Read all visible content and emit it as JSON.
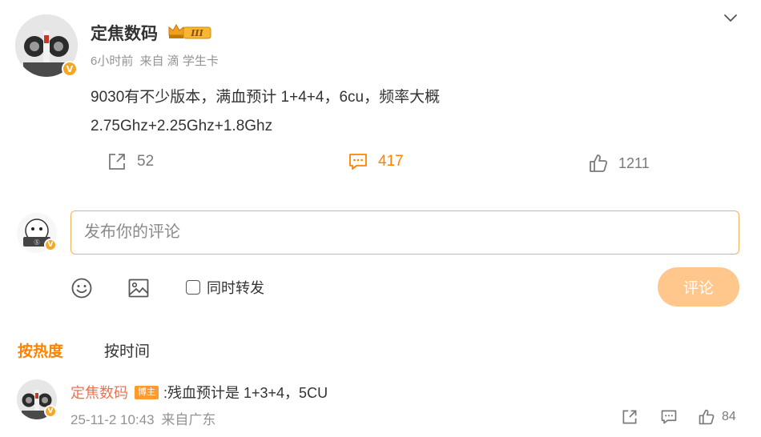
{
  "post": {
    "author_name": "定焦数码",
    "level_badge": "III",
    "time": "6小时前",
    "source": "来自 滴 学生卡",
    "text_line1": "9030有不少版本，满血预计 1+4+4，6cu，频率大概",
    "text_line2": "2.75Ghz+2.25Ghz+1.8Ghz",
    "repost_count": "52",
    "comment_count": "417",
    "like_count": "1211"
  },
  "composer": {
    "placeholder": "发布你的评论",
    "repost_label": "同时转发",
    "submit_label": "评论"
  },
  "sort": {
    "hot_label": "按热度",
    "time_label": "按时间"
  },
  "reply": {
    "author": "定焦数码",
    "blogger_tag": "博主",
    "text": ":残血预计是 1+3+4，5CU",
    "time": "25-11-2 10:43",
    "source": "来自广东",
    "like_count": "84"
  },
  "colors": {
    "accent": "#ff8200",
    "submit_disabled": "#ffc78c",
    "verified_badge": "#f5a623",
    "reply_author": "#eb7350",
    "meta_gray": "#939393"
  },
  "icons": [
    "avatar",
    "crown-level-badge",
    "chevron-down-icon",
    "share-icon",
    "comment-icon",
    "like-icon",
    "emoji-icon",
    "image-icon",
    "verified-badge"
  ]
}
